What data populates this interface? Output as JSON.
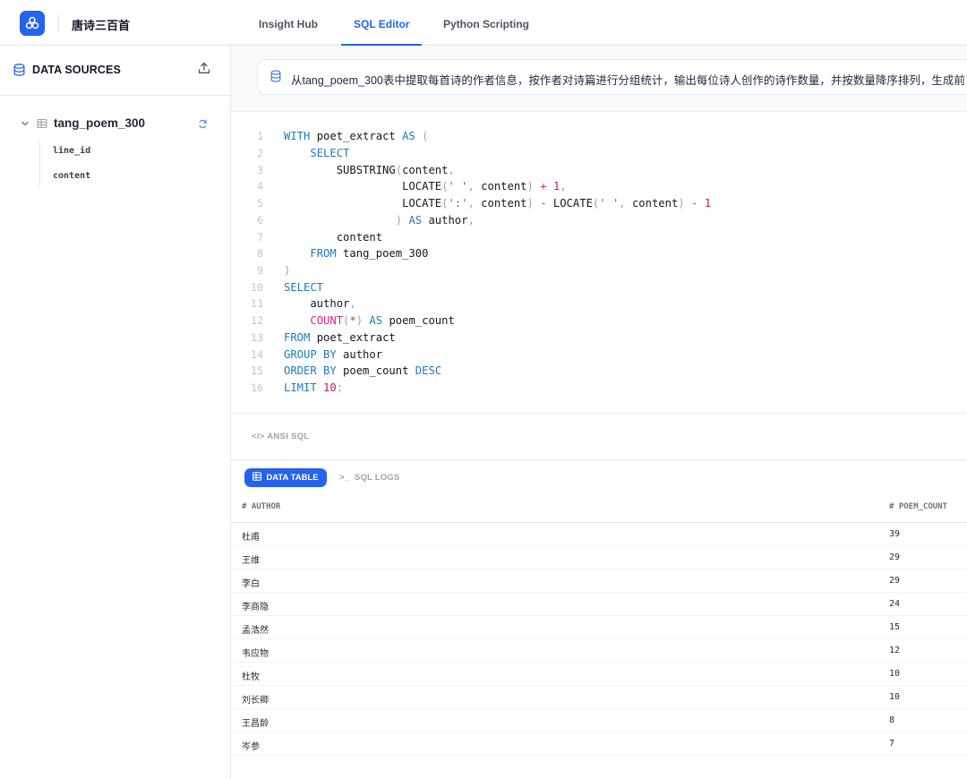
{
  "app": {
    "title": "唐诗三百首"
  },
  "tabs": [
    {
      "label": "Insight Hub"
    },
    {
      "label": "SQL Editor"
    },
    {
      "label": "Python Scripting"
    }
  ],
  "active_tab": "SQL Editor",
  "sidebar": {
    "title": "DATA SOURCES",
    "table": {
      "name": "tang_poem_300",
      "columns": [
        "line_id",
        "content"
      ]
    }
  },
  "prompt": {
    "text": "从tang_poem_300表中提取每首诗的作者信息，按作者对诗篇进行分组统计，输出每位诗人创作的诗作数量，并按数量降序排列，生成前"
  },
  "editor": {
    "line_numbers": [
      "1",
      "2",
      "3",
      "4",
      "5",
      "6",
      "7",
      "8",
      "9",
      "10",
      "11",
      "12",
      "13",
      "14",
      "15",
      "16"
    ],
    "dialect": "ANSI SQL"
  },
  "results": {
    "tab_active": "DATA TABLE",
    "tab_other": "SQL LOGS",
    "columns": [
      "AUTHOR",
      "POEM_COUNT"
    ],
    "rows": [
      {
        "author": "杜甫",
        "count": "39"
      },
      {
        "author": "王维",
        "count": "29"
      },
      {
        "author": "李白",
        "count": "29"
      },
      {
        "author": "李商隐",
        "count": "24"
      },
      {
        "author": "孟浩然",
        "count": "15"
      },
      {
        "author": "韦应物",
        "count": "12"
      },
      {
        "author": "杜牧",
        "count": "10"
      },
      {
        "author": "刘长卿",
        "count": "10"
      },
      {
        "author": "王昌龄",
        "count": "8"
      },
      {
        "author": "岑参",
        "count": "7"
      }
    ]
  },
  "colors": {
    "accent": "#2563eb",
    "keyword": "#1e7ab8",
    "number": "#c2185b"
  }
}
